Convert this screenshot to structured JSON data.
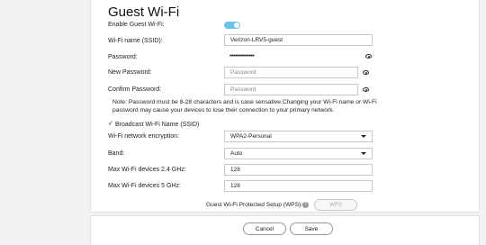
{
  "page": {
    "title": "Guest Wi-Fi"
  },
  "form": {
    "enable_label": "Enable Guest Wi-Fi:",
    "enable_state": "on",
    "ssid_label": "Wi-Fi name (SSID):",
    "ssid_value": "Verizon-LRV5-guest",
    "password_label": "Password:",
    "password_value": "••••••••••••••",
    "new_password_label": "New Password:",
    "new_password_placeholder": "Password",
    "confirm_password_label": "Confirm Password:",
    "confirm_password_placeholder": "Password",
    "note": "Note: Password must be 8-28 characters and is case sensative.Changing your Wi-Fi name or Wi-Fi password may cause your devices to lose their connection to your primary network.",
    "broadcast_label": "Broadcast Wi-Fi Name (SSID)",
    "broadcast_checked": true,
    "encryption_label": "Wi-Fi network encryption:",
    "encryption_value": "WPA2-Personal",
    "band_label": "Band:",
    "band_value": "Auto",
    "max24_label": "Max Wi-Fi devices 2.4 GHz:",
    "max24_value": "128",
    "max5_label": "Max Wi-Fi devices 5 GHz:",
    "max5_value": "128",
    "wps_label": "Guest Wi-Fi Protected Setup (WPS):",
    "wps_button": "WPS",
    "help_glyph": "?",
    "check_glyph": "✓"
  },
  "footer": {
    "cancel_label": "Cancel",
    "save_label": "Save"
  },
  "colors": {
    "toggle_on": "#6ac2e8"
  }
}
